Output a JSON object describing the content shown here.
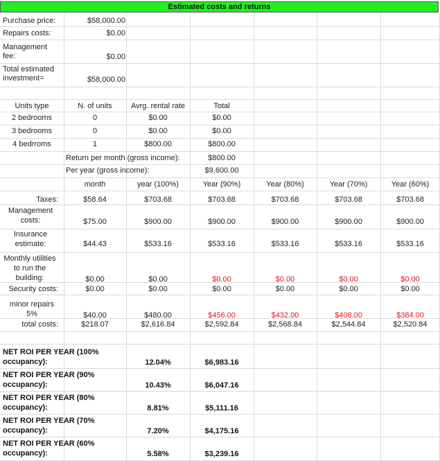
{
  "title": "Estimated costs and returns",
  "investment": {
    "purchase_label": "Purchase price:",
    "purchase_value": "$58,000.00",
    "repairs_label": "Repairs costs:",
    "repairs_value": "$0.00",
    "management_label": "Management fee:",
    "management_value": "$0.00",
    "total_label": "Total estimated investment=",
    "total_value": "$58,000.00"
  },
  "units": {
    "headers": [
      "Units type",
      "N. of units",
      "Avrg. rental rate",
      "Total"
    ],
    "rows": [
      {
        "type": "2 bedrooms",
        "count": "0",
        "rate": "$0.00",
        "total": "$0.00"
      },
      {
        "type": "3 bedrooms",
        "count": "0",
        "rate": "$0.00",
        "total": "$0.00"
      },
      {
        "type": "4 bedrroms",
        "count": "1",
        "rate": "$800.00",
        "total": "$800.00"
      }
    ],
    "monthly_label": "Return per month (gross income):",
    "monthly_value": "$800.00",
    "yearly_label": "Per year (gross income):",
    "yearly_value": "$9,600.00"
  },
  "costs": {
    "headers": [
      "month",
      "year (100%)",
      "Year (90%)",
      "Year (80%)",
      "Year (70%)",
      "Year (60%)"
    ],
    "rows": [
      {
        "label": "Taxes:",
        "values": [
          "$58.64",
          "$703.68",
          "$703.68",
          "$703.68",
          "$703.68",
          "$703.68"
        ]
      },
      {
        "label": "Management costs:",
        "values": [
          "$75.00",
          "$900.00",
          "$900.00",
          "$900.00",
          "$900.00",
          "$900.00"
        ]
      },
      {
        "label": "Insurance estimate:",
        "values": [
          "$44.43",
          "$533.16",
          "$533.16",
          "$533.16",
          "$533.16",
          "$533.16"
        ]
      },
      {
        "label": "Monthly utilities to run the building:",
        "values": [
          "$0.00",
          "$0.00",
          "$0.00",
          "$0.00",
          "$0.00",
          "$0.00"
        ]
      },
      {
        "label": "Security costs:",
        "values": [
          "$0.00",
          "$0.00",
          "$0.00",
          "$0.00",
          "$0.00",
          "$0.00"
        ]
      },
      {
        "label": "minor repairs 5%",
        "values": [
          "$40.00",
          "$480.00",
          "$456.00",
          "$432.00",
          "$408.00",
          "$384.00"
        ]
      },
      {
        "label": "total costs:",
        "values": [
          "$218.07",
          "$2,616.84",
          "$2,592.84",
          "$2,568.84",
          "$2,544.84",
          "$2,520.84"
        ]
      }
    ],
    "highlight_color": "#e0171f"
  },
  "roi": [
    {
      "label": "NET ROI PER YEAR (100% occupancy):",
      "percent": "12.04%",
      "amount": "$6,983.16"
    },
    {
      "label": "NET ROI PER YEAR (90% occupancy):",
      "percent": "10.43%",
      "amount": "$6,047.16"
    },
    {
      "label": "NET ROI PER YEAR (80% occupancy):",
      "percent": "8.81%",
      "amount": "$5,111.16"
    },
    {
      "label": "NET ROI PER YEAR (70% occupancy):",
      "percent": "7.20%",
      "amount": "$4,175.16"
    },
    {
      "label": "NET ROI PER YEAR (60% occupancy):",
      "percent": "5.58%",
      "amount": "$3,239.16"
    }
  ]
}
